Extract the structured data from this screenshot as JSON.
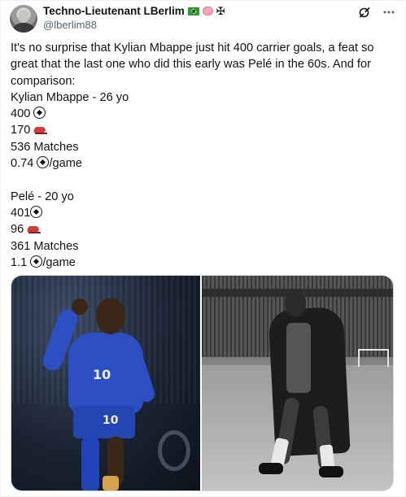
{
  "author": {
    "display_name": "Techno-Lieutenant LBerlim",
    "handle": "@lberlim88",
    "name_emojis": [
      "brazil-flag",
      "brain",
      "iron-cross"
    ]
  },
  "top_actions": {
    "icons": [
      "grok-icon",
      "more-icon"
    ]
  },
  "tweet": {
    "intro": "It's no surprise that Kylian Mbappe just hit 400 carrier goals, a feat so great that the last one who did this early was Pelé in the 60s. And for comparison:",
    "mbappe": {
      "heading": "Kylian Mbappe - 26 yo",
      "goals": "400",
      "assists": "170",
      "matches": "536 Matches",
      "ratio": "0.74",
      "ratio_suffix": "/game"
    },
    "pele": {
      "heading": "Pelé - 20 yo",
      "goals": "401",
      "assists": "96",
      "matches": "361 Matches",
      "ratio": "1.1",
      "ratio_suffix": "/game"
    }
  },
  "media": {
    "photos": [
      "mbappe-celebrating-photo",
      "pele-black-and-white-photo"
    ],
    "mbappe_shirt_number": "10",
    "pele_shirt_number": ""
  },
  "colors": {
    "text": "#0f1419",
    "secondary_text": "#536471",
    "border": "#cfd9de"
  }
}
